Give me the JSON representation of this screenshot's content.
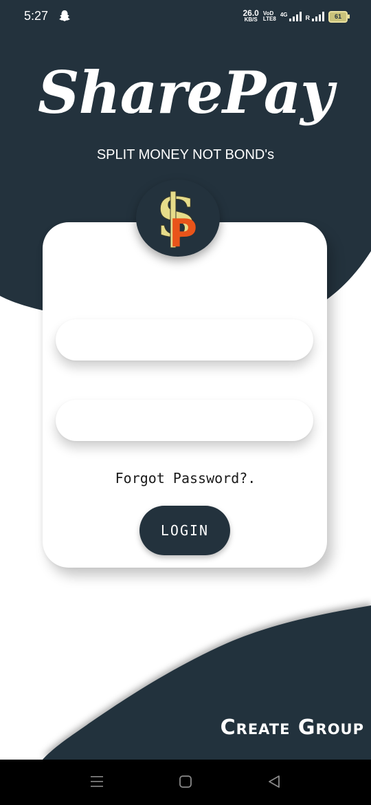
{
  "status_bar": {
    "time": "5:27",
    "net_speed_value": "26.0",
    "net_speed_unit": "KB/S",
    "volte_top": "VoD",
    "volte_bottom": "LTE8",
    "network_type": "4G",
    "roaming": "R",
    "battery": "61"
  },
  "brand": {
    "title": "SharePay",
    "tagline": "SPLIT MONEY NOT BOND's"
  },
  "form": {
    "username_placeholder": "",
    "password_placeholder": "",
    "forgot_label": "Forgot Password?.",
    "login_label": "LOGIN"
  },
  "footer": {
    "create_group_label": "Create Group"
  },
  "colors": {
    "primary_dark": "#23323d",
    "logo_gold": "#e6dc8a",
    "logo_orange": "#e9541a"
  },
  "icons": {
    "logo": "dollar-sign-logo-icon",
    "snapchat": "snapchat-icon",
    "nav_menu": "menu-icon",
    "nav_home": "home-icon",
    "nav_back": "back-icon"
  }
}
